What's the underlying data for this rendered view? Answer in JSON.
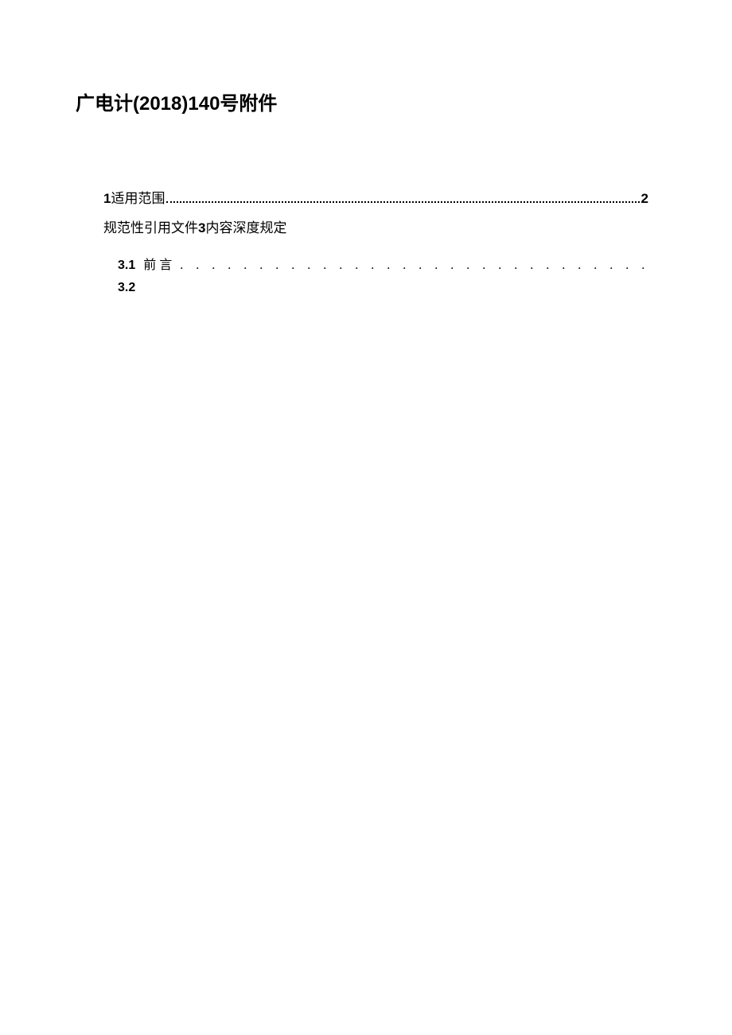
{
  "title": "广电计(2018)140号附件",
  "toc": {
    "entry1": {
      "num": "1",
      "label": "适用范围",
      "page": "2"
    },
    "entry2": {
      "prefix": "规范性引用文件",
      "mid": "3",
      "suffix": "内容深度规定"
    },
    "entry3": {
      "num": "3.1",
      "label": "前言",
      "dots": ". . . . . . . . . . . . . . . . . . . . . . . . . . . . . . . . . . . . . . . . . . . . . . . . . . . . . . . . . ."
    },
    "entry4": {
      "num": "3.2"
    }
  }
}
